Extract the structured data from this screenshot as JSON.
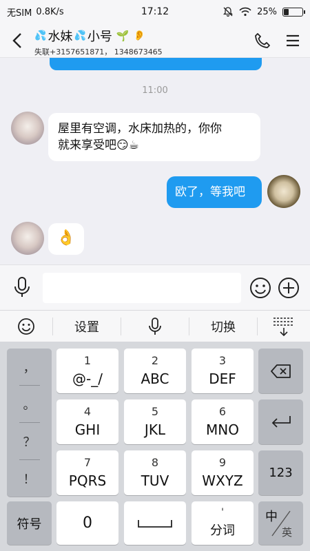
{
  "status_bar": {
    "carrier": "无SIM",
    "speed": "0.8K/s",
    "time": "17:12",
    "battery": "25%"
  },
  "header": {
    "contact_name_parts": [
      "水妹",
      "小号"
    ],
    "subtitle": "失联+3157651871， 1348673465"
  },
  "chat": {
    "timestamp": "11:00",
    "messages": [
      {
        "side": "left",
        "text": "屋里有空调，水床加热的，你你",
        "text2": "就来享受吧😏☕"
      },
      {
        "side": "right",
        "text": "欧了，等我吧"
      },
      {
        "side": "left",
        "text": "👌"
      }
    ]
  },
  "ime_toolbar": {
    "settings": "设置",
    "switch": "切换"
  },
  "keyboard": {
    "punctuation": [
      "，",
      "。",
      "？",
      "！"
    ],
    "keys": [
      {
        "num": "1",
        "letters": "@-_/"
      },
      {
        "num": "2",
        "letters": "ABC"
      },
      {
        "num": "3",
        "letters": "DEF"
      },
      {
        "num": "4",
        "letters": "GHI"
      },
      {
        "num": "5",
        "letters": "JKL"
      },
      {
        "num": "6",
        "letters": "MNO"
      },
      {
        "num": "7",
        "letters": "PQRS"
      },
      {
        "num": "8",
        "letters": "TUV"
      },
      {
        "num": "9",
        "letters": "WXYZ"
      }
    ],
    "symbols": "符号",
    "zero": "0",
    "fenci_top": "'",
    "fenci": "分词",
    "numeric": "123",
    "lang_zh": "中",
    "lang_en": "英"
  },
  "colors": {
    "accent": "#1f9bf0",
    "keyboard_bg": "#d6d8dc"
  }
}
